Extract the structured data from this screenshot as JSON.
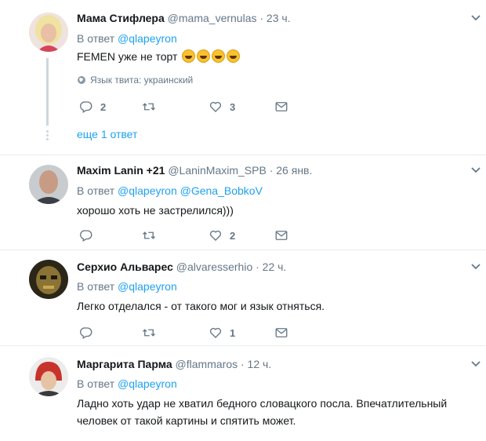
{
  "tweets": [
    {
      "name": "Мама Стифлера",
      "handle": "@mama_vernulas",
      "time": "· 23 ч.",
      "reply_prefix": "В ответ",
      "reply_to": [
        "@qlapeyron"
      ],
      "text": "FEMEN уже не торт",
      "emoji_count": 4,
      "emoji_name": "rolling-on-floor-laughing-emoji",
      "lang_label": "Язык твита: украинский",
      "replies": "2",
      "retweets": "",
      "likes": "3",
      "more_replies": "еще 1 ответ"
    },
    {
      "name": "Maxim Lanin +21",
      "handle": "@LaninMaxim_SPB",
      "time": "· 26 янв.",
      "reply_prefix": "В ответ",
      "reply_to": [
        "@qlapeyron",
        "@Gena_BobkoV"
      ],
      "text": "хорошо хоть не застрелился)))",
      "replies": "",
      "retweets": "",
      "likes": "2"
    },
    {
      "name": "Серхио Альварес",
      "handle": "@alvaresserhio",
      "time": "· 22 ч.",
      "reply_prefix": "В ответ",
      "reply_to": [
        "@qlapeyron"
      ],
      "text": "Легко отделался - от такого мог и язык отняться.",
      "replies": "",
      "retweets": "",
      "likes": "1"
    },
    {
      "name": "Маргарита Парма",
      "handle": "@flammaros",
      "time": "· 12 ч.",
      "reply_prefix": "В ответ",
      "reply_to": [
        "@qlapeyron"
      ],
      "text": "Ладно хоть удар не хватил бедного словацкого посла. Впечатлительный человек от такой картины и спятить может."
    }
  ],
  "colors": {
    "link": "#1da1f2",
    "muted": "#657786",
    "divider": "#e6ecf0"
  },
  "icons": [
    "reply-icon",
    "retweet-icon",
    "like-icon",
    "dm-icon",
    "chevron-down-icon",
    "globe-icon"
  ]
}
